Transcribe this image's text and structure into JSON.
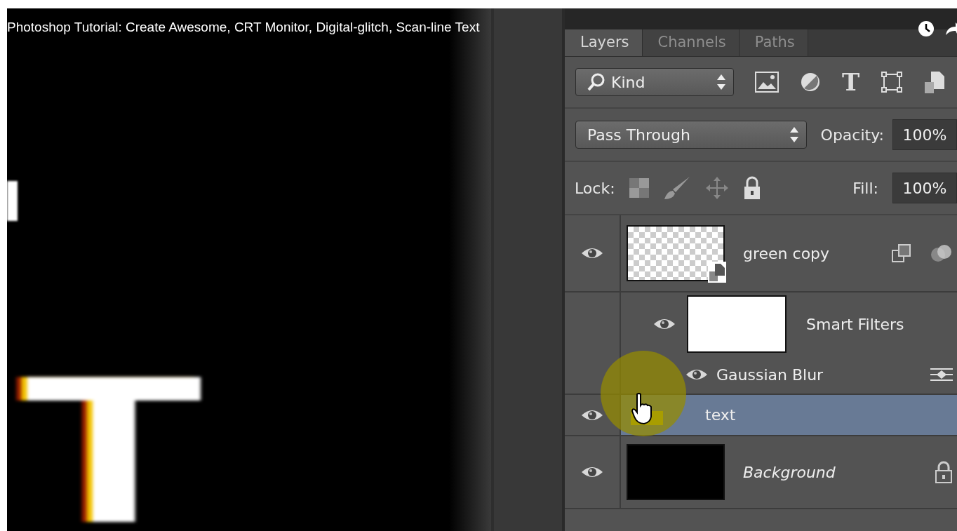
{
  "video": {
    "title": "Photoshop Tutorial: Create Awesome, CRT Monitor, Digital-glitch, Scan-line Text"
  },
  "canvas": {
    "text": "T"
  },
  "layers_panel": {
    "tabs": [
      {
        "label": "Layers",
        "selected": true
      },
      {
        "label": "Channels",
        "selected": false
      },
      {
        "label": "Paths",
        "selected": false
      }
    ],
    "filter": {
      "value": "Kind",
      "buttons": [
        {
          "kind": "pixel"
        },
        {
          "kind": "adjustment"
        },
        {
          "kind": "type",
          "glyph": "T"
        },
        {
          "kind": "shape"
        },
        {
          "kind": "smart"
        }
      ]
    },
    "blend_mode": {
      "value": "Pass Through"
    },
    "opacity": {
      "label": "Opacity:",
      "value": "100%"
    },
    "lock": {
      "label": "Lock:"
    },
    "fill": {
      "label": "Fill:",
      "value": "100%"
    },
    "layers": [
      {
        "name": "green copy",
        "kind": "smart",
        "visible": true,
        "selected": false,
        "children": [
          {
            "name": "Smart Filters",
            "kind": "filter-mask",
            "visible": true,
            "selected": false,
            "children": [
              {
                "name": "Gaussian Blur",
                "kind": "filter",
                "visible": true,
                "selected": false
              }
            ]
          }
        ]
      },
      {
        "name": "text",
        "kind": "group",
        "visible": true,
        "selected": true
      },
      {
        "name": "Background",
        "kind": "background",
        "visible": true,
        "selected": false
      }
    ]
  }
}
